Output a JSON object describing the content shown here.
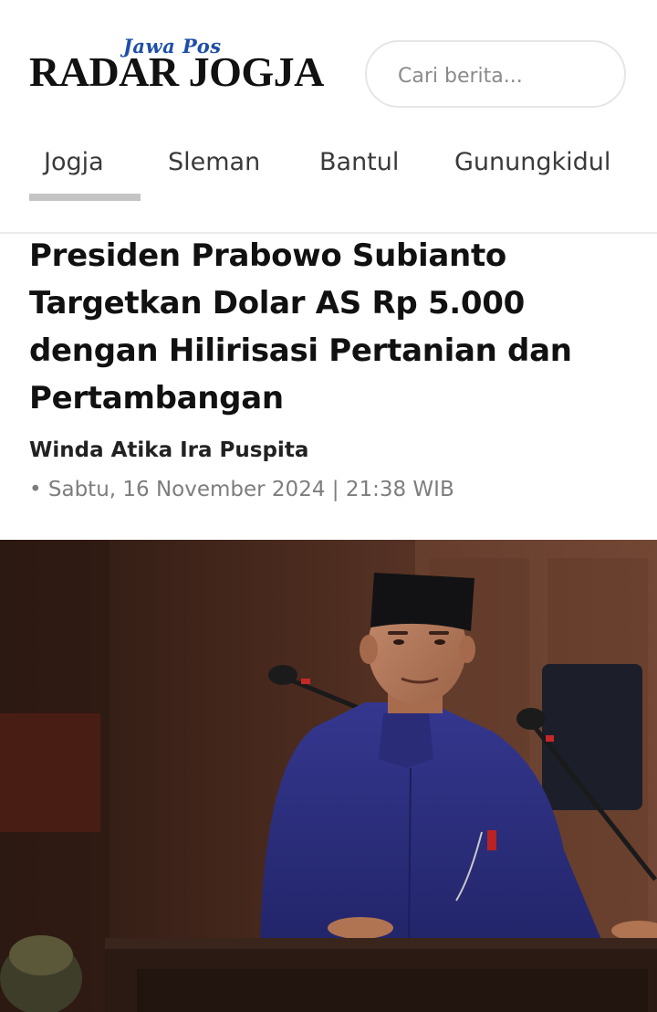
{
  "header": {
    "logo_top": "Jawa Pos",
    "logo_main": "RADAR JOGJA",
    "search_placeholder": "Cari berita..."
  },
  "nav": {
    "tabs": [
      "Jogja",
      "Sleman",
      "Bantul",
      "Gunungkidul"
    ],
    "active_tab": "Jogja"
  },
  "article": {
    "title": "Presiden Prabowo Subianto Targetkan Dolar AS Rp 5.000 dengan Hilirisasi Pertanian dan Pertambangan",
    "author": "Winda Atika Ira Puspita",
    "meta": "• Sabtu, 16 November 2024 | 21:38 WIB"
  },
  "colors": {
    "logo_blue": "#1e4ea8",
    "active_tab_bar": "#c4c4c4",
    "meta_gray": "#7d7d7d",
    "suit_navy": "#2d2f7d"
  }
}
